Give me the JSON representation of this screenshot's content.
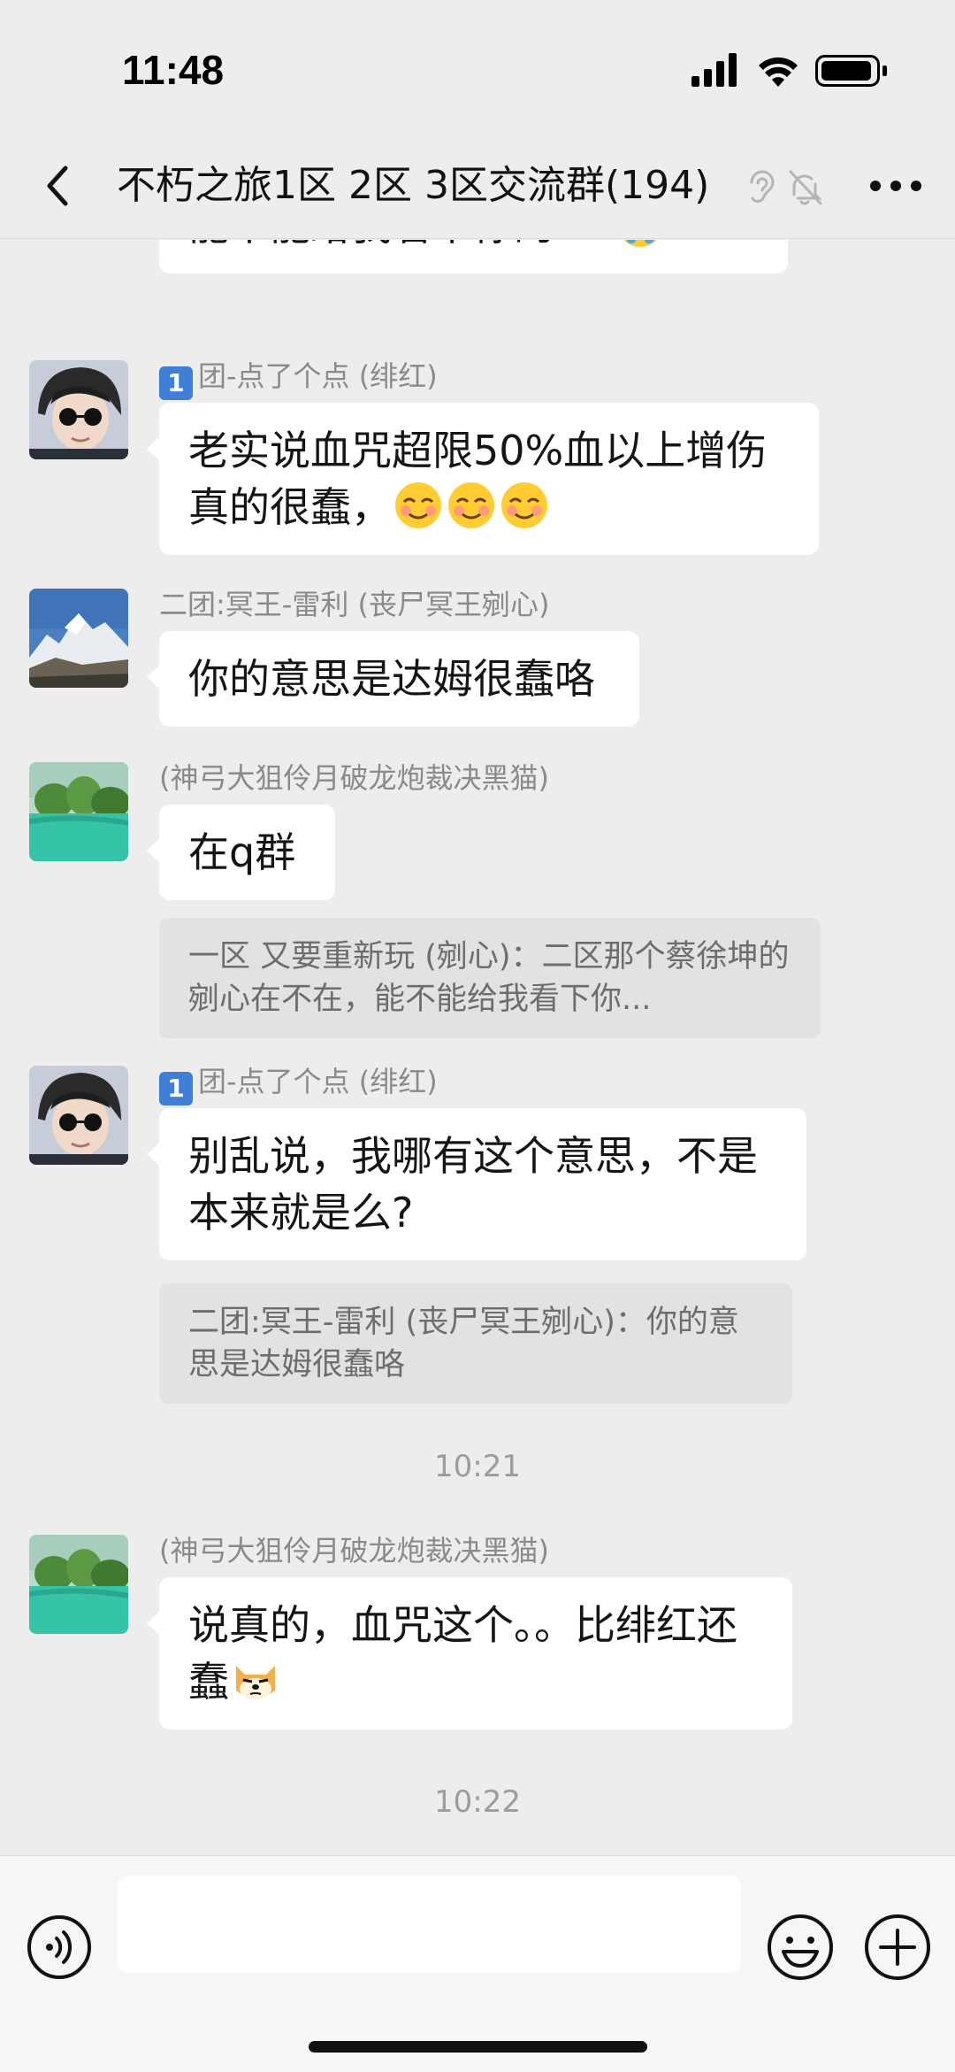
{
  "status_bar": {
    "time": "11:48"
  },
  "nav": {
    "title": "不朽之旅1区 2区 3区交流群(194)"
  },
  "messages": [
    {
      "text": "能不能给我看下你的BD"
    },
    {
      "sender": "团-点了个点 (绯红)",
      "badge": "1",
      "text": "老实说血咒超限50%血以上增伤真的很蠢，"
    },
    {
      "sender": "二团:冥王-雷利 (丧尸冥王剜心)",
      "text": "你的意思是达姆很蠢咯"
    },
    {
      "sender": "(神弓大狙伶月破龙炮裁决黑猫)",
      "text": "在q群",
      "quote": "一区 又要重新玩 (剜心)：二区那个蔡徐坤的剜心在不在，能不能给我看下你..."
    },
    {
      "sender": "团-点了个点 (绯红)",
      "badge": "1",
      "text": "别乱说，我哪有这个意思，不是本来就是么?",
      "quote": "二团:冥王-雷利 (丧尸冥王剜心)：你的意思是达姆很蠢咯"
    },
    {
      "timestamp": "10:21"
    },
    {
      "sender": "(神弓大狙伶月破龙炮裁决黑猫)",
      "text": "说真的，血咒这个。。比绯红还蠢"
    },
    {
      "timestamp": "10:22"
    }
  ],
  "input": {
    "placeholder": ""
  },
  "icons": {
    "back": "chevron-left-icon",
    "ear": "ear-icon",
    "mute": "bell-slash-icon",
    "more": "ellipsis-icon",
    "voice": "voice-icon",
    "emoji": "smiley-icon",
    "plus": "plus-icon"
  }
}
